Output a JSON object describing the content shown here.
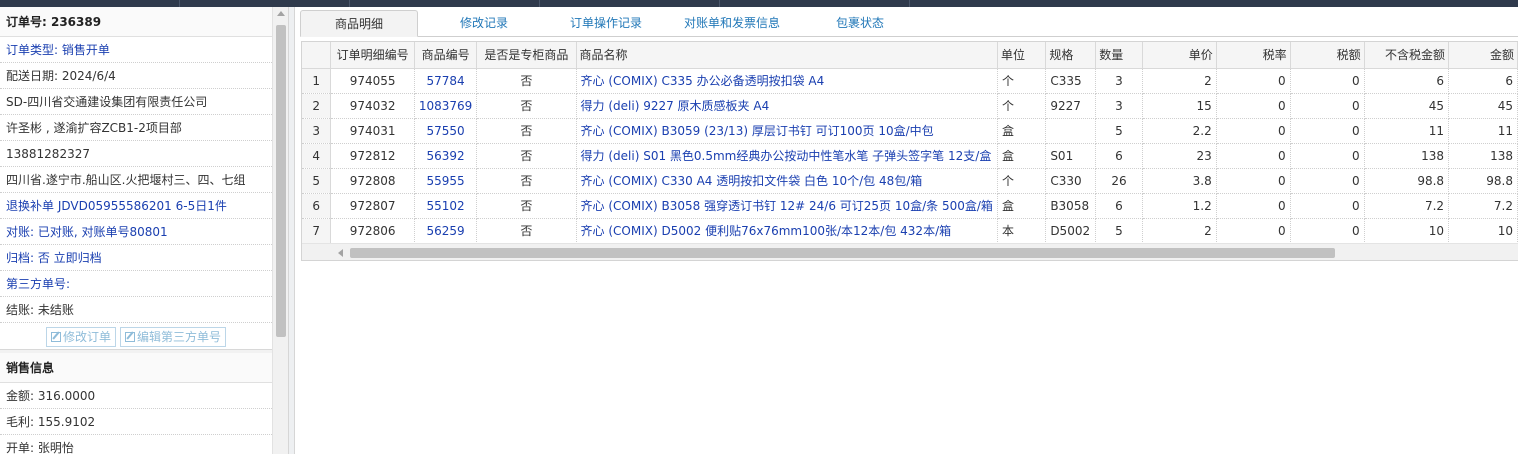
{
  "order": {
    "number_label": "订单号: 236389",
    "type": "订单类型: 销售开单",
    "date": "配送日期: 2024/6/4",
    "company": "SD-四川省交通建设集团有限责任公司",
    "contact": "许圣彬 , 遂渝扩容ZCB1-2项目部",
    "phone": "13881282327",
    "address": "四川省.遂宁市.船山区.火把堰村三、四、七组",
    "exchange": "退换补单 JDVD05955586201 6-5日1件",
    "reconcile": "对账: 已对账, 对账单号80801",
    "archive": "归档: 否 立即归档",
    "third_party": "第三方单号:",
    "settle": "结账: 未结账",
    "edit_button": "修改订单",
    "edit_third_button": "编辑第三方单号"
  },
  "sales": {
    "title": "销售信息",
    "amount": "金额: 316.0000",
    "profit": "毛利: 155.9102",
    "issuer": "开单: 张明怡"
  },
  "tabs": [
    {
      "label": "商品明细"
    },
    {
      "label": "修改记录"
    },
    {
      "label": "订单操作记录"
    },
    {
      "label": "对账单和发票信息"
    },
    {
      "label": "包裹状态"
    }
  ],
  "table": {
    "headers": [
      "",
      "订单明细编号",
      "商品编号",
      "是否是专柜商品",
      "商品名称",
      "单位",
      "规格",
      "数量",
      "单价",
      "税率",
      "税额",
      "不含税金额",
      "金额"
    ],
    "rows": [
      [
        "1",
        "974055",
        "57784",
        "否",
        "齐心 (COMIX) C335 办公必备透明按扣袋 A4",
        "个",
        "C335",
        "3",
        "2",
        "0",
        "0",
        "6",
        "6"
      ],
      [
        "2",
        "974032",
        "1083769",
        "否",
        "得力 (deli) 9227 原木质感板夹 A4",
        "个",
        "9227",
        "3",
        "15",
        "0",
        "0",
        "45",
        "45"
      ],
      [
        "3",
        "974031",
        "57550",
        "否",
        "齐心 (COMIX) B3059 (23/13) 厚层订书钉 可订100页 10盒/中包",
        "盒",
        "",
        "5",
        "2.2",
        "0",
        "0",
        "11",
        "11"
      ],
      [
        "4",
        "972812",
        "56392",
        "否",
        "得力 (deli) S01 黑色0.5mm经典办公按动中性笔水笔 子弹头签字笔 12支/盒",
        "盒",
        "S01",
        "6",
        "23",
        "0",
        "0",
        "138",
        "138"
      ],
      [
        "5",
        "972808",
        "55955",
        "否",
        "齐心 (COMIX) C330 A4 透明按扣文件袋 白色 10个/包 48包/箱",
        "个",
        "C330",
        "26",
        "3.8",
        "0",
        "0",
        "98.8",
        "98.8"
      ],
      [
        "6",
        "972807",
        "55102",
        "否",
        "齐心 (COMIX) B3058 强穿透订书钉 12# 24/6 可订25页 10盒/条 500盒/箱",
        "盒",
        "B3058",
        "6",
        "1.2",
        "0",
        "0",
        "7.2",
        "7.2"
      ],
      [
        "7",
        "972806",
        "56259",
        "否",
        "齐心 (COMIX) D5002 便利贴76x76mm100张/本12本/包 432本/箱",
        "本",
        "D5002",
        "5",
        "2",
        "0",
        "0",
        "10",
        "10"
      ]
    ]
  }
}
